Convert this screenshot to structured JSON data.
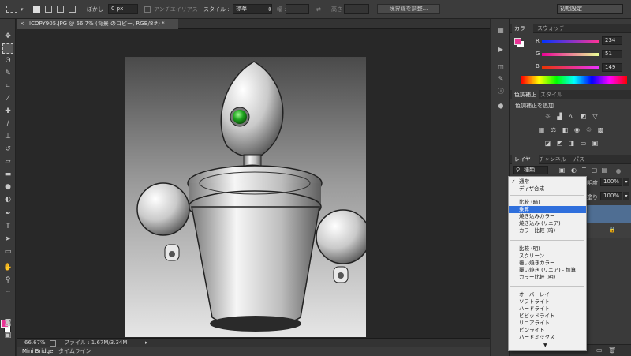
{
  "options_bar": {
    "feather_label": "ぼかし :",
    "feather_value": "0 px",
    "antialias_label": "アンチエイリアス",
    "style_label": "スタイル :",
    "style_value": "標準",
    "width_label": "幅 :",
    "height_label": "高さ :",
    "refine_edge_button": "境界線を調整...",
    "workspace_value": "初期設定"
  },
  "document": {
    "tab_title": "ICOPY905.JPG @ 66.7% (背景 のコピー, RGB/8#) *",
    "zoom": "66.67%",
    "file_info": "ファイル : 1.67M/3.34M"
  },
  "bottom_tabs": [
    "Mini Bridge",
    "タイムライン"
  ],
  "color_panel": {
    "tabs": [
      "カラー",
      "スウォッチ"
    ],
    "r_label": "R",
    "r_value": "234",
    "g_label": "G",
    "g_value": "51",
    "b_label": "B",
    "b_value": "149",
    "foreground_color": "#ea3395"
  },
  "adjustments_panel": {
    "tabs": [
      "色調補正",
      "スタイル"
    ],
    "add_label": "色調補正を追加"
  },
  "layers_panel": {
    "tabs": [
      "レイヤー",
      "チャンネル",
      "パス"
    ],
    "kind_filter": "種類",
    "opacity_label": "明度 :",
    "opacity_value": "100%",
    "fill_label": "塗り :",
    "fill_value": "100%"
  },
  "blend_menu": {
    "items": [
      {
        "label": "通常",
        "checked": true
      },
      {
        "label": "ディザ合成"
      },
      {
        "label": "比較 (暗)"
      },
      {
        "label": "乗算",
        "selected": true
      },
      {
        "label": "焼き込みカラー"
      },
      {
        "label": "焼き込み (リニア)"
      },
      {
        "label": "カラー比較 (暗)"
      },
      {
        "label": "比較 (明)"
      },
      {
        "label": "スクリーン"
      },
      {
        "label": "覆い焼きカラー"
      },
      {
        "label": "覆い焼き (リニア) - 加算"
      },
      {
        "label": "カラー比較 (明)"
      },
      {
        "label": "オーバーレイ"
      },
      {
        "label": "ソフトライト"
      },
      {
        "label": "ハードライト"
      },
      {
        "label": "ビビッドライト"
      },
      {
        "label": "リニアライト"
      },
      {
        "label": "ピンライト"
      },
      {
        "label": "ハードミックス"
      }
    ],
    "check_mark": "✓",
    "more_arrow": "▼",
    "highlight_color": "#2f6fdc"
  },
  "colors": {
    "foreground_swatch": "#ea3395",
    "background_swatch": "#ffffff"
  }
}
